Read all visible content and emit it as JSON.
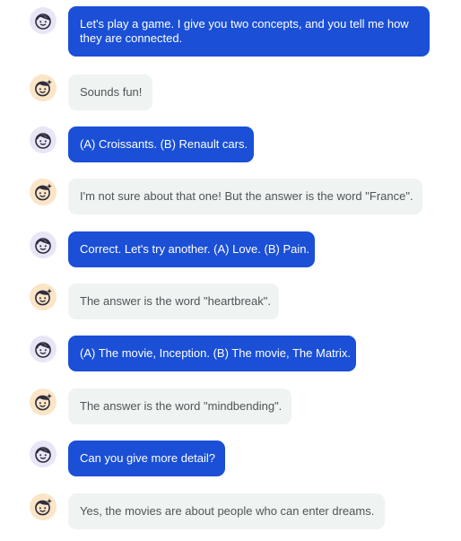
{
  "colors": {
    "user_bubble": "#1a4fd6",
    "bot_bubble": "#eff3f2",
    "user_avatar_bg": "#e8e6f6",
    "bot_avatar_bg": "#fbe5c7"
  },
  "messages": [
    {
      "sender": "user",
      "avatar_icon": "user-face-icon",
      "text": "Let's play a game. I give you two concepts, and you tell me how they are connected."
    },
    {
      "sender": "bot",
      "avatar_icon": "bot-face-sparkle-icon",
      "text": "Sounds fun!"
    },
    {
      "sender": "user",
      "avatar_icon": "user-face-icon",
      "text": "(A) Croissants. (B) Renault cars."
    },
    {
      "sender": "bot",
      "avatar_icon": "bot-face-sparkle-icon",
      "text": "I'm not sure about that one! But the answer is the word \"France\"."
    },
    {
      "sender": "user",
      "avatar_icon": "user-face-icon",
      "text": "Correct. Let's try another. (A) Love. (B) Pain."
    },
    {
      "sender": "bot",
      "avatar_icon": "bot-face-sparkle-icon",
      "text": "The answer is the word \"heartbreak\"."
    },
    {
      "sender": "user",
      "avatar_icon": "user-face-icon",
      "text": "(A) The movie, Inception. (B) The movie, The Matrix."
    },
    {
      "sender": "bot",
      "avatar_icon": "bot-face-sparkle-icon",
      "text": "The answer is the word \"mindbending\"."
    },
    {
      "sender": "user",
      "avatar_icon": "user-face-icon",
      "text": "Can you give more detail?"
    },
    {
      "sender": "bot",
      "avatar_icon": "bot-face-sparkle-icon",
      "text": "Yes, the movies are about people who can enter dreams."
    }
  ]
}
